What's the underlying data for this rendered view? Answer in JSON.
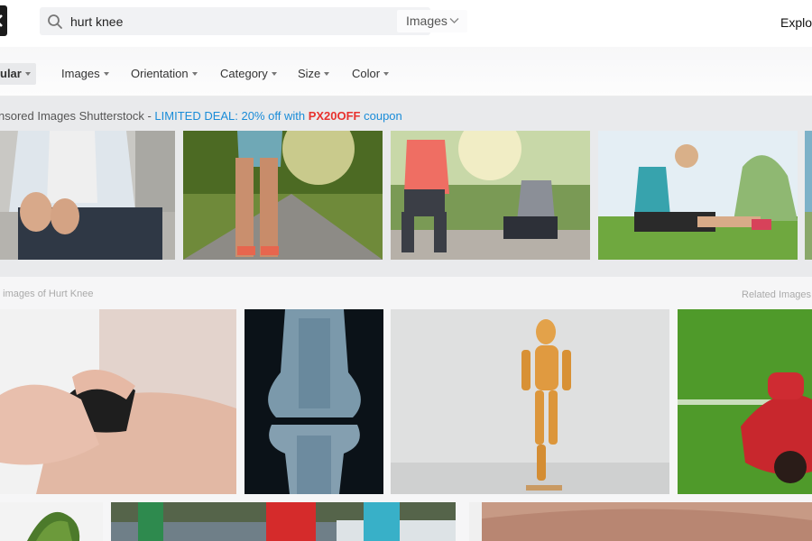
{
  "header": {
    "search": {
      "value": "hurt knee",
      "type_label": "Images"
    },
    "explore_label": "Explore"
  },
  "filters": [
    {
      "label": "Popular",
      "visible": "ular",
      "active": true
    },
    {
      "label": "Images"
    },
    {
      "label": "Orientation"
    },
    {
      "label": "Category"
    },
    {
      "label": "Size"
    },
    {
      "label": "Color"
    }
  ],
  "sponsored": {
    "prefix": "nsored Images Shutterstock - ",
    "deal": "LIMITED DEAL: 20% off with ",
    "code": "PX20OFF",
    "suffix": " coupon"
  },
  "related": {
    "left_label": "e images of Hurt Knee",
    "right_label": "Related Images"
  }
}
